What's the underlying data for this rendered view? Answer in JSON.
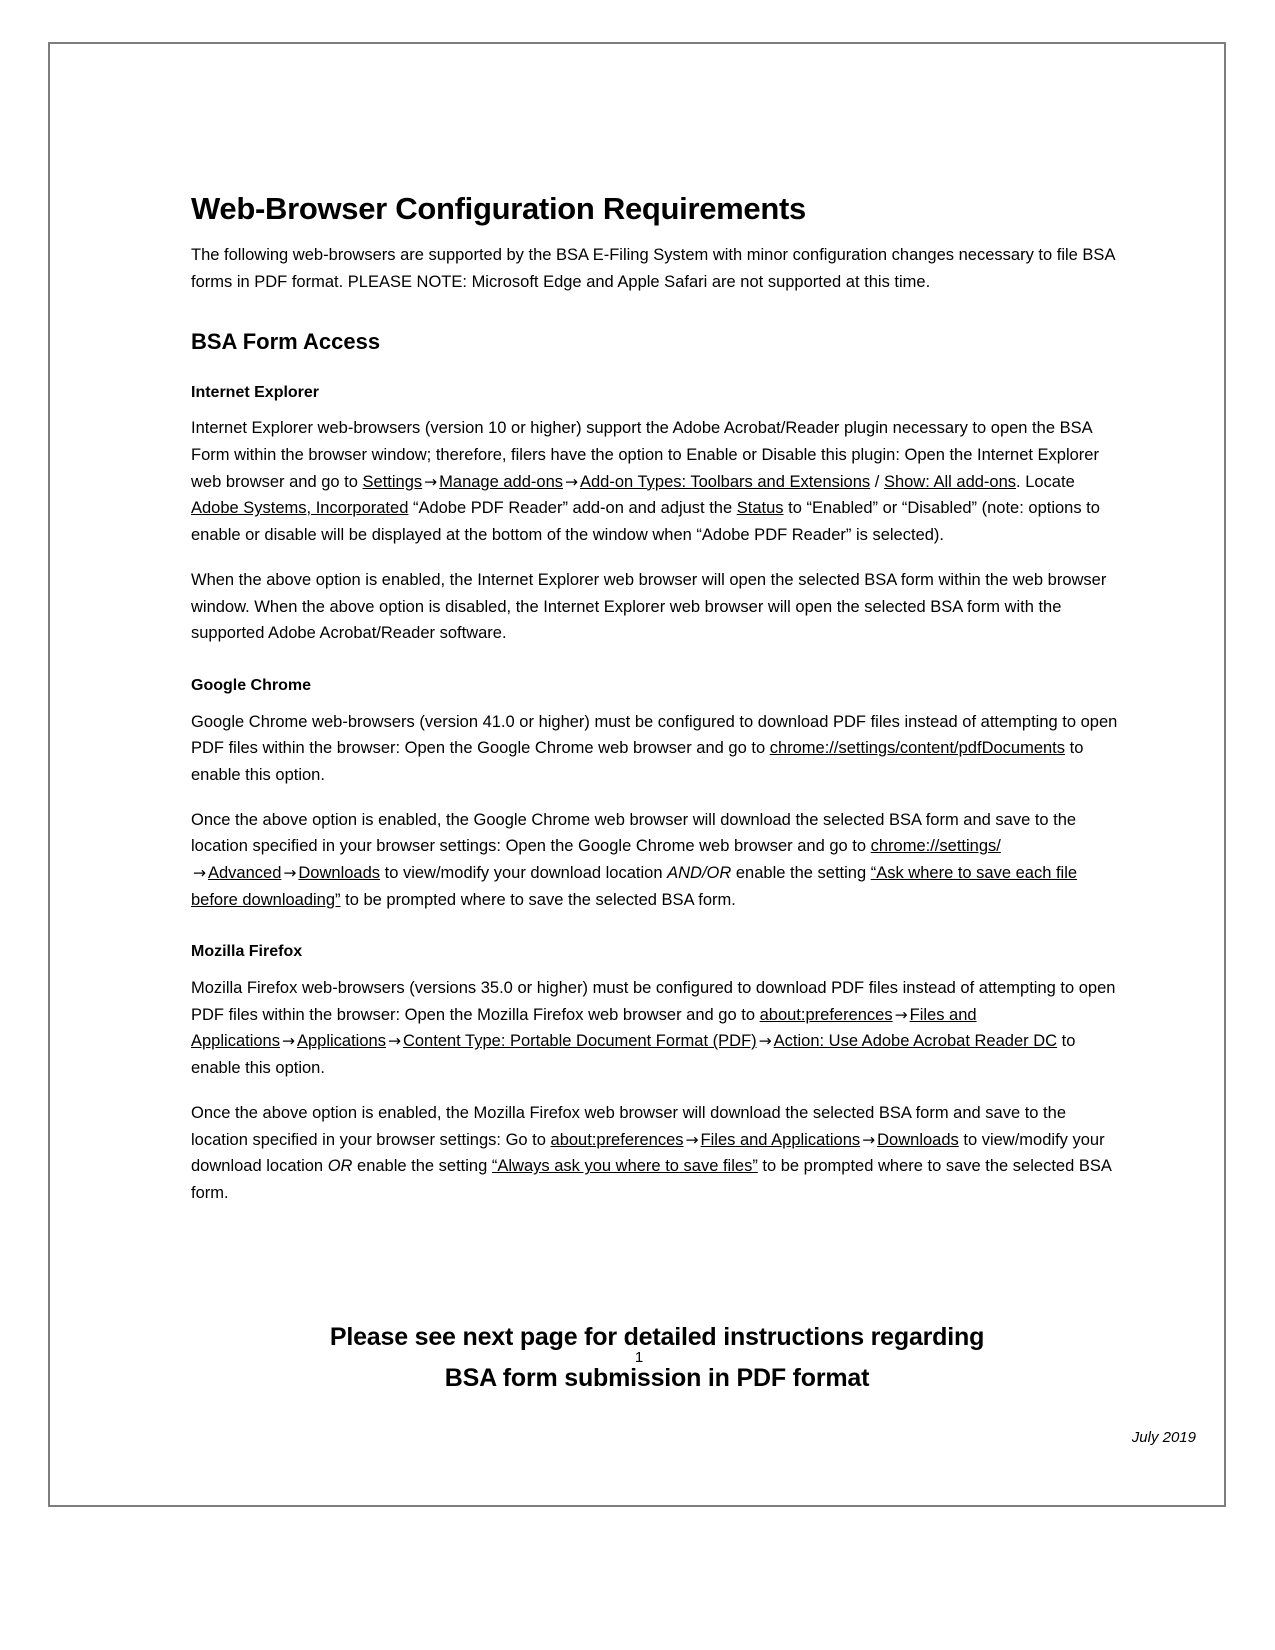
{
  "document": {
    "title": "Web-Browser Configuration Requirements",
    "intro": "The following web-browsers are supported by the BSA E-Filing System with minor configuration changes necessary to file BSA forms in PDF format. PLEASE NOTE: Microsoft Edge and Apple Safari are not supported at this time.",
    "section_title": "BSA Form Access",
    "internet_explorer": {
      "heading": "Internet Explorer",
      "para1_part1": "Internet Explorer web-browsers (version 10 or higher) support the Adobe Acrobat/Reader plugin necessary to open the BSA Form within the browser window; therefore, filers have the option to Enable or Disable this plugin: Open the Internet Explorer web browser and go to ",
      "link_settings": "Settings",
      "arrow": "→",
      "link_manage_addons": "Manage add-ons",
      "link_addon_types": "Add-on Types: Toolbars and Extensions",
      "slash": " / ",
      "link_show_all": "Show: All add-ons",
      "para1_part2": ". Locate ",
      "link_adobe_systems": "Adobe Systems, Incorporated",
      "para1_part3": " “Adobe PDF Reader” add-on and adjust the ",
      "link_status": "Status",
      "para1_part4": " to “Enabled” or “Disabled” (note: options to enable or disable will be displayed at the bottom of the window when “Adobe PDF Reader” is selected).",
      "para2": "When the above option is enabled, the Internet Explorer web browser will open the selected BSA form within the web browser window. When the above option is disabled, the Internet Explorer web browser will open the selected BSA form with the supported Adobe Acrobat/Reader software."
    },
    "google_chrome": {
      "heading": "Google Chrome",
      "para1_part1": "Google Chrome web-browsers (version 41.0 or higher) must be configured to download PDF files instead of attempting to open PDF files within the browser:  Open the Google Chrome web browser and go to ",
      "link_pdf_documents": "chrome://settings/content/pdfDocuments",
      "para1_part2": " to enable this option.",
      "para2_part1": "Once the above option is enabled, the Google Chrome web browser will download the selected BSA form and save to the location specified in your browser settings:  Open the Google Chrome web browser and go to ",
      "link_settings": "chrome://settings/",
      "arrow": "→",
      "link_advanced": "Advanced",
      "link_downloads": "Downloads",
      "para2_part2": " to view/modify your download location ",
      "emphasis_andor": "AND/OR",
      "para2_part3": " enable the setting ",
      "link_ask_where": "“Ask where to save each file before downloading”",
      "para2_part4": " to be prompted where to save the selected BSA form."
    },
    "mozilla_firefox": {
      "heading": "Mozilla Firefox",
      "para1_part1": "Mozilla Firefox web-browsers (versions 35.0 or higher) must be configured to download PDF files instead of attempting to open PDF files within the browser: Open the Mozilla Firefox web browser and go to ",
      "link_about_preferences": "about:preferences",
      "arrow": "→",
      "link_files_and_applications": "Files and Applications",
      "link_applications": "Applications",
      "link_content_type": "Content Type: Portable Document Format (PDF)",
      "link_action": "Action: Use Adobe Acrobat Reader DC",
      "para1_part2": " to enable this option.",
      "para2_part1": "Once the above option is enabled, the Mozilla Firefox web browser will download the selected BSA form and save to the location specified in your browser settings:  Go to ",
      "link_about_preferences2": "about:preferences",
      "link_files_and_applications2": "Files and Applications",
      "link_downloads": "Downloads",
      "para2_part2": " to view/modify your download location ",
      "emphasis_or": "OR",
      "para2_part3": " enable the setting ",
      "link_always_ask": "“Always ask you where to save files”",
      "para2_part4": " to be prompted where to save the selected BSA form."
    },
    "closing_line1": "Please see next page for detailed instructions regarding",
    "closing_line2": "BSA form submission in PDF format",
    "page_number": "1",
    "footer_date": "July 2019"
  }
}
